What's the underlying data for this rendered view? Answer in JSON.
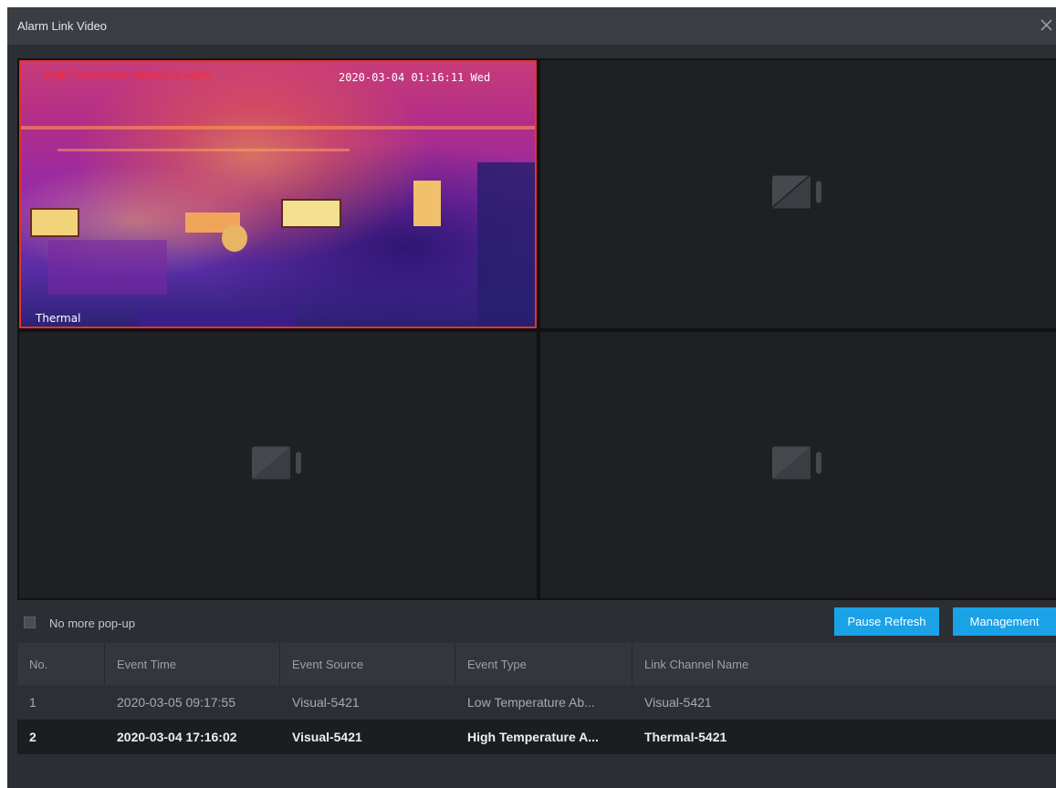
{
  "window": {
    "title": "Alarm Link Video"
  },
  "video": {
    "panel1": {
      "alarm_text": "High Temperature Abnormal Alarm",
      "osd_time": "2020-03-04 01:16:11 Wed",
      "osd_label": "Thermal",
      "border_color": "#e5332b"
    },
    "empty_panel_icon": "camera-placeholder-icon"
  },
  "controls": {
    "no_popup_label": "No more pop-up",
    "no_popup_checked": false,
    "pause_refresh": "Pause Refresh",
    "management": "Management",
    "accent": "#1aa1e6"
  },
  "table": {
    "columns": [
      "No.",
      "Event Time",
      "Event Source",
      "Event Type",
      "Link Channel Name"
    ],
    "rows": [
      {
        "no": "1",
        "time": "2020-03-05 09:17:55",
        "source": "Visual-5421",
        "type": "Low Temperature Ab...",
        "channel": "Visual-5421"
      },
      {
        "no": "2",
        "time": "2020-03-04 17:16:02",
        "source": "Visual-5421",
        "type": "High Temperature A...",
        "channel": "Thermal-5421"
      }
    ]
  }
}
